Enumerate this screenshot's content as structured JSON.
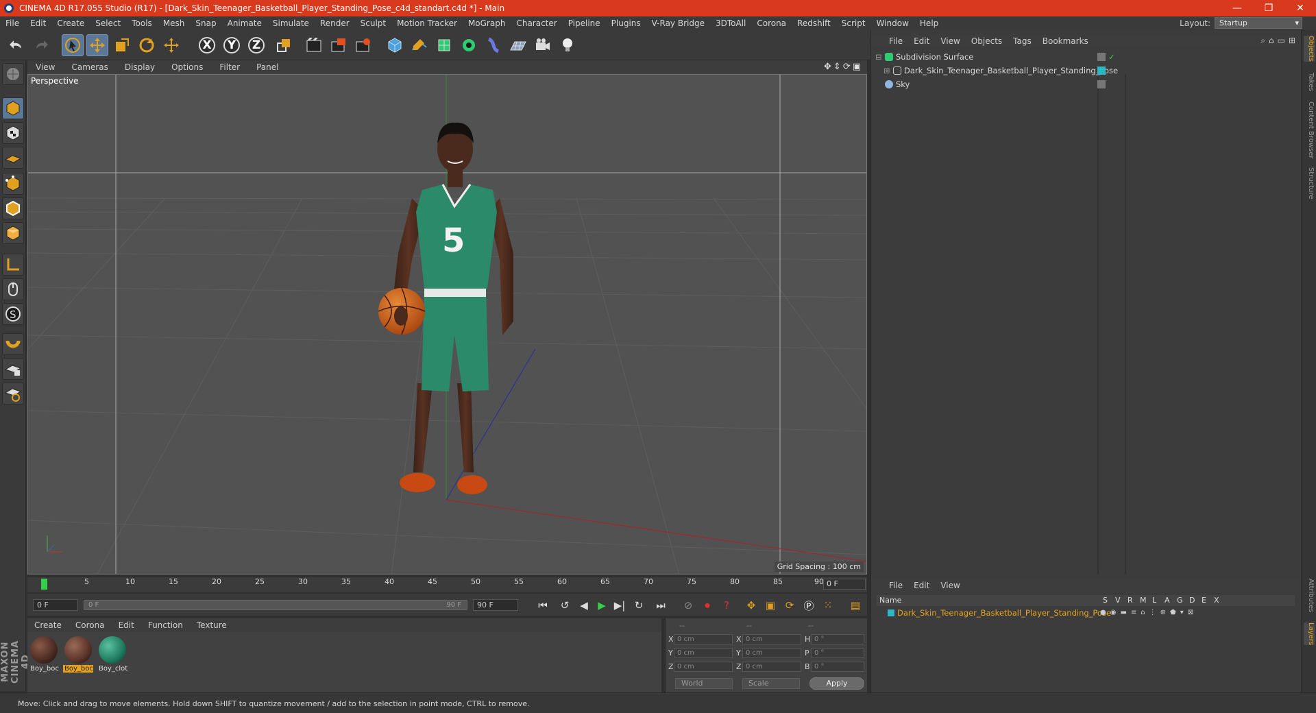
{
  "window": {
    "title": "CINEMA 4D R17.055 Studio (R17) - [Dark_Skin_Teenager_Basketball_Player_Standing_Pose_c4d_standart.c4d *] - Main",
    "controls": [
      "—",
      "❐",
      "✕"
    ]
  },
  "menubar": {
    "items": [
      "File",
      "Edit",
      "Create",
      "Select",
      "Tools",
      "Mesh",
      "Snap",
      "Animate",
      "Simulate",
      "Render",
      "Sculpt",
      "Motion Tracker",
      "MoGraph",
      "Character",
      "Pipeline",
      "Plugins",
      "V-Ray Bridge",
      "3DToAll",
      "Corona",
      "Redshift",
      "Script",
      "Window",
      "Help"
    ],
    "layout_label": "Layout:",
    "layout_value": "Startup"
  },
  "toolbar": {
    "axis_x": "X",
    "axis_y": "Y",
    "axis_z": "Z"
  },
  "viewport": {
    "menu": [
      "View",
      "Cameras",
      "Display",
      "Options",
      "Filter",
      "Panel"
    ],
    "camera_label": "Perspective",
    "grid_spacing": "Grid Spacing : 100 cm",
    "jersey_number": "5"
  },
  "timeline": {
    "ticks": [
      "0",
      "5",
      "10",
      "15",
      "20",
      "25",
      "30",
      "35",
      "40",
      "45",
      "50",
      "55",
      "60",
      "65",
      "70",
      "75",
      "80",
      "85",
      "90"
    ],
    "current_frame": "0 F"
  },
  "transport": {
    "start_field": "0 F",
    "range_start": "0 F",
    "range_end": "90 F",
    "end_field": "90 F"
  },
  "materials": {
    "menu": [
      "Create",
      "Corona",
      "Edit",
      "Function",
      "Texture"
    ],
    "items": [
      {
        "label": "Boy_boc",
        "color": "#4a2a22"
      },
      {
        "label": "Boy_boc",
        "color": "#5a3328"
      },
      {
        "label": "Boy_clot",
        "color": "#1f7a5e"
      }
    ]
  },
  "coordinates": {
    "header": [
      "--",
      "--",
      "--"
    ],
    "rows": [
      {
        "a": "X",
        "av": "0 cm",
        "b": "X",
        "bv": "0 cm",
        "c": "H",
        "cv": "0 °"
      },
      {
        "a": "Y",
        "av": "0 cm",
        "b": "Y",
        "bv": "0 cm",
        "c": "P",
        "cv": "0 °"
      },
      {
        "a": "Z",
        "av": "0 cm",
        "b": "Z",
        "bv": "0 cm",
        "c": "B",
        "cv": "0 °"
      }
    ],
    "space": "World",
    "mode": "Scale",
    "apply": "Apply"
  },
  "object_manager": {
    "menu": [
      "File",
      "Edit",
      "View",
      "Objects",
      "Tags",
      "Bookmarks"
    ],
    "objects": [
      {
        "name": "Subdivision Surface",
        "icon_color": "#5bc0de"
      },
      {
        "name": "Dark_Skin_Teenager_Basketball_Player_Standing_Pose",
        "icon_color": "#9aa0a8"
      },
      {
        "name": "Sky",
        "icon_color": "#8fb6e0"
      }
    ]
  },
  "layer_manager": {
    "menu": [
      "File",
      "Edit",
      "View"
    ],
    "columns": [
      "Name",
      "S",
      "V",
      "R",
      "M",
      "L",
      "A",
      "G",
      "D",
      "E",
      "X"
    ],
    "layer_name": "Dark_Skin_Teenager_Basketball_Player_Standing_Pose",
    "layer_color": "#2bb7c4"
  },
  "side_tabs": [
    "Objects",
    "Takes",
    "Content Browser",
    "Structure"
  ],
  "side_tabs_bottom": [
    "Attributes",
    "Layers"
  ],
  "branding": "MAXON CINEMA 4D",
  "status": "Move: Click and drag to move elements. Hold down SHIFT to quantize movement / add to the selection in point mode, CTRL to remove.",
  "colors": {
    "title_bar": "#d9391c",
    "accent": "#e8a31c",
    "playhead": "#35d04a"
  }
}
